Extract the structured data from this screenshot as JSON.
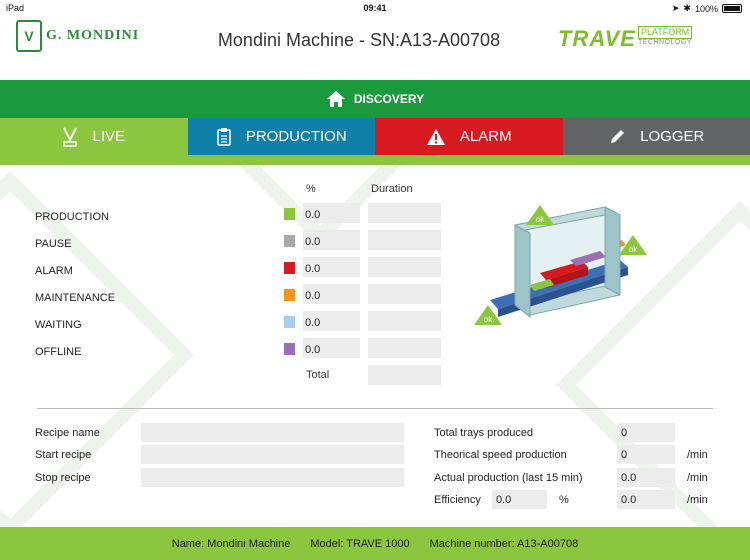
{
  "status_bar": {
    "carrier": "iPad",
    "time": "09:41",
    "battery": "100%"
  },
  "header": {
    "brand_left": "G. MONDINI",
    "title": "Mondini Machine - SN:A13-A00708",
    "brand_right": "TRAVE",
    "brand_right_platform": "PLATFORM",
    "brand_right_tech": "TECHNOLOGY"
  },
  "nav": {
    "discovery": "DISCOVERY",
    "tabs": [
      {
        "id": "live",
        "label": "LIVE",
        "color": "#8cc63f"
      },
      {
        "id": "production",
        "label": "PRODUCTION",
        "color": "#0f80a8"
      },
      {
        "id": "alarm",
        "label": "ALARM",
        "color": "#d71920"
      },
      {
        "id": "logger",
        "label": "LOGGER",
        "color": "#636466"
      }
    ]
  },
  "states": {
    "col_pct": "%",
    "col_duration": "Duration",
    "total_label": "Total",
    "rows": [
      {
        "label": "PRODUCTION",
        "color": "#8cc63f",
        "pct": "0.0",
        "duration": ""
      },
      {
        "label": "PAUSE",
        "color": "#a7a9ac",
        "pct": "0.0",
        "duration": ""
      },
      {
        "label": "ALARM",
        "color": "#d71920",
        "pct": "0.0",
        "duration": ""
      },
      {
        "label": "MAINTENANCE",
        "color": "#f7941d",
        "pct": "0.0",
        "duration": ""
      },
      {
        "label": "WAITING",
        "color": "#a9cdef",
        "pct": "0.0",
        "duration": ""
      },
      {
        "label": "OFFLINE",
        "color": "#9b6fb5",
        "pct": "0.0",
        "duration": ""
      }
    ],
    "total_duration": ""
  },
  "machine_diagram": {
    "ok_label": "ok"
  },
  "recipe": {
    "name_label": "Recipe name",
    "name_value": "",
    "start_label": "Start recipe",
    "start_value": "",
    "stop_label": "Stop recipe",
    "stop_value": ""
  },
  "production_stats": {
    "trays_label": "Total trays produced",
    "trays_value": "0",
    "theoretical_label": "Theorical speed production",
    "theoretical_value": "0",
    "theoretical_unit": "/min",
    "actual_label": "Actual production (last 15 min)",
    "actual_value": "0.0",
    "actual_unit": "/min",
    "efficiency_label": "Efficiency",
    "efficiency_value": "0.0",
    "efficiency_pct": "%",
    "efficiency_rate": "0.0",
    "efficiency_unit": "/min"
  },
  "footer": {
    "name": "Name: Mondini Machine",
    "model": "Model: TRAVE 1000",
    "number": "Machine number: A13-A00708"
  }
}
